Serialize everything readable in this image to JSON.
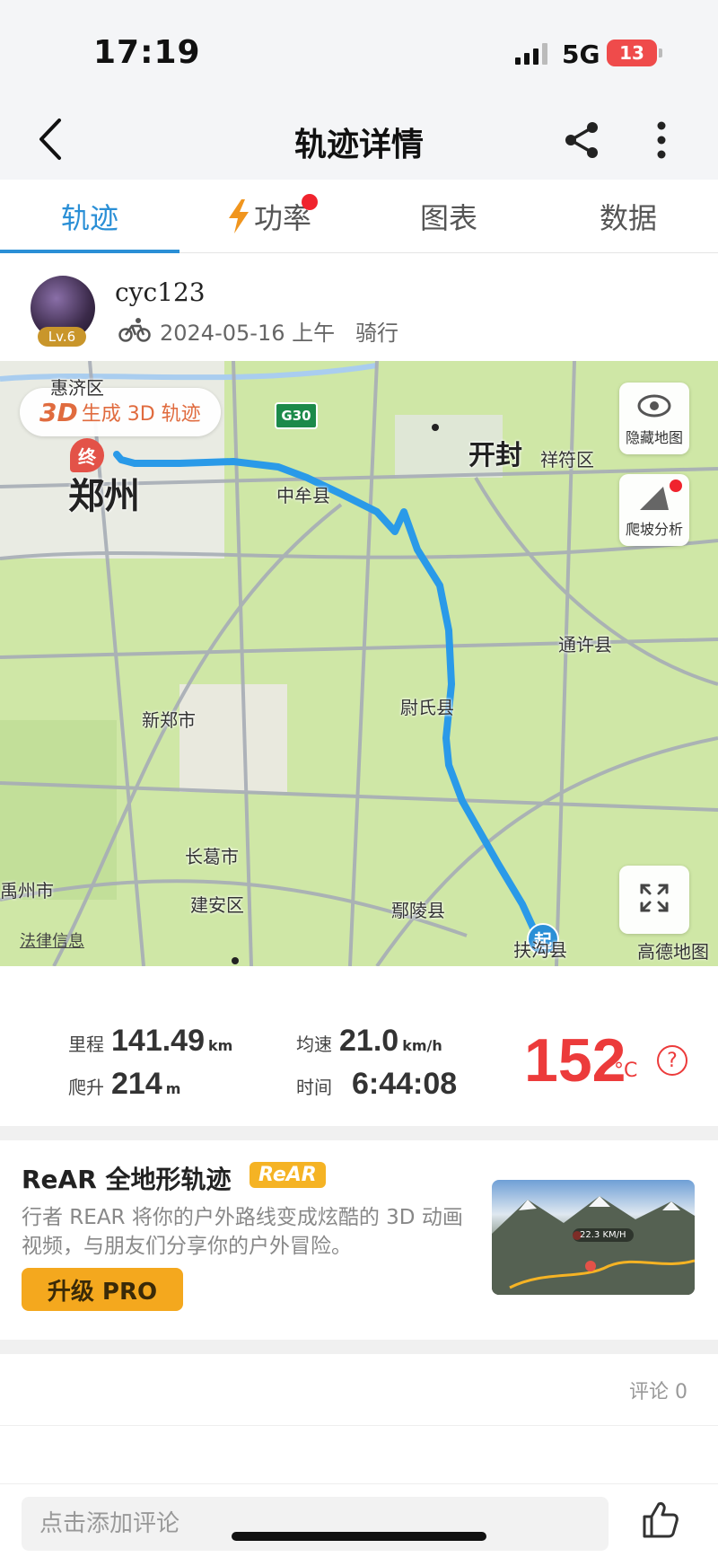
{
  "status_bar": {
    "time": "17:19",
    "network": "5G",
    "battery": "13"
  },
  "nav": {
    "title": "轨迹详情",
    "back_icon": "chevron-left-icon",
    "share_icon": "share-icon",
    "more_icon": "more-vertical-icon"
  },
  "tabs": [
    {
      "label": "轨迹",
      "active": true
    },
    {
      "label": "功率",
      "icon": "lightning-bolt-icon",
      "has_dot": true
    },
    {
      "label": "图表"
    },
    {
      "label": "数据"
    }
  ],
  "user": {
    "name": "cyc123",
    "level": "Lv.6",
    "date": "2024-05-16 上午",
    "activity": "骑行"
  },
  "map": {
    "btn_3d_tag": "3D",
    "btn_3d_label": "生成 3D 轨迹",
    "hide_map_label": "隐藏地图",
    "climb_label": "爬坡分析",
    "legal": "法律信息",
    "brand": "高德地图",
    "start_label": "起",
    "end_label": "终",
    "highway": "G30",
    "places": {
      "zhengzhou": "郑州",
      "kaifeng": "开封",
      "xiangfu": "祥符区",
      "zhongmou": "中牟县",
      "tongxu": "通许县",
      "weishi": "尉氏县",
      "xinzheng": "新郑市",
      "changge": "长葛市",
      "jianan": "建安区",
      "yuzhou": "禹州市",
      "yanling": "鄢陵县",
      "fugou": "扶沟县",
      "huiji": "惠济区"
    },
    "route_color": "#2a9ae8"
  },
  "stats": {
    "distance_label": "里程",
    "distance": "141.49",
    "distance_unit": "km",
    "speed_label": "均速",
    "speed": "21.0",
    "speed_unit": "km/h",
    "climb_label": "爬升",
    "climb": "214",
    "climb_unit": "m",
    "time_label": "时间",
    "time": "6:44:08",
    "temperature": "152",
    "temp_unit": "°C",
    "help_icon": "question-circle-icon"
  },
  "promo": {
    "title": "ReAR 全地形轨迹",
    "badge": "ReAR",
    "description": "行者 REAR 将你的户外路线变成炫酷的 3D 动画视频，与朋友们分享你的户外冒险。",
    "button": "升级 PRO",
    "thumb_speed": "22.3 KM/H"
  },
  "comments": {
    "count_label": "评论 0",
    "input_placeholder": "点击添加评论",
    "like_icon": "thumbs-up-icon"
  }
}
